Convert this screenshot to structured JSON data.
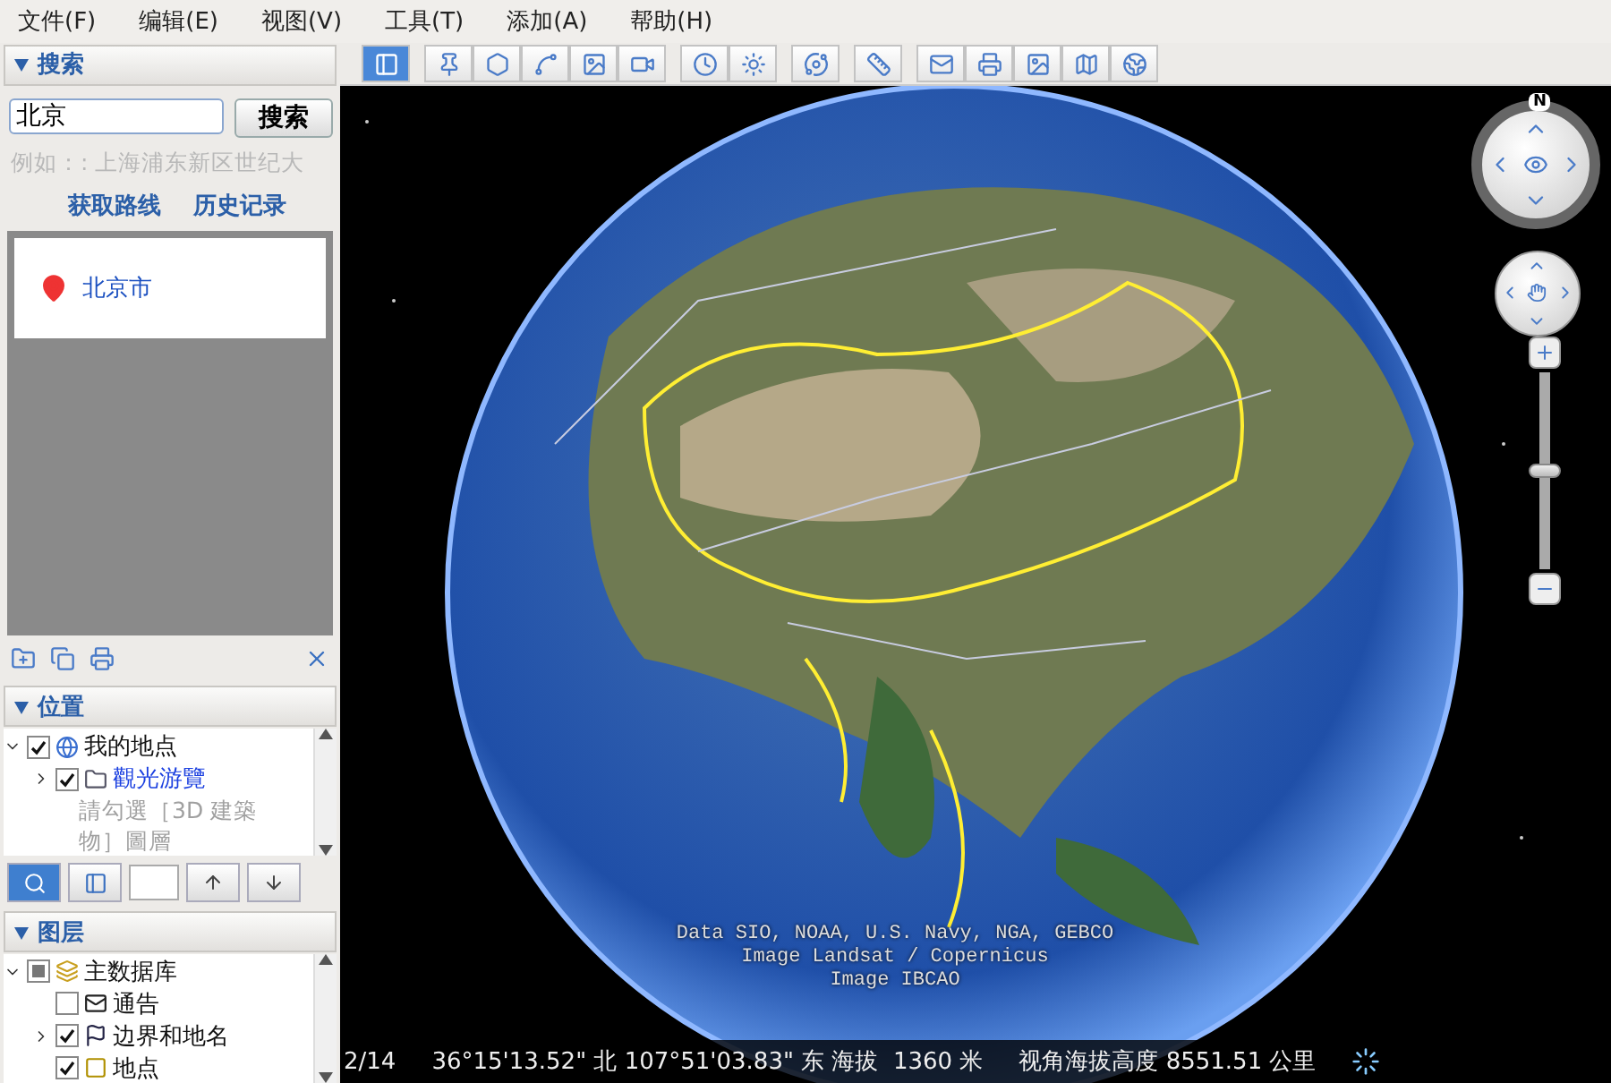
{
  "menu": [
    {
      "label": "文件(F)"
    },
    {
      "label": "编辑(E)"
    },
    {
      "label": "视图(V)"
    },
    {
      "label": "工具(T)"
    },
    {
      "label": "添加(A)"
    },
    {
      "label": "帮助(H)"
    }
  ],
  "search": {
    "title": "搜索",
    "expanded": true,
    "query": "北京",
    "button": "搜索",
    "hint": "例如：: 上海浦东新区世纪大",
    "links": [
      "获取路线",
      "历史记录"
    ],
    "results": [
      {
        "name": "北京市"
      }
    ]
  },
  "places": {
    "title": "位置",
    "expanded": true,
    "tree": [
      {
        "label": "我的地点",
        "kind": "globe",
        "checked": true,
        "expanded": true,
        "link": false,
        "children": [
          {
            "label": "觀光游覽",
            "kind": "folder",
            "checked": true,
            "expanded": false,
            "link": true,
            "note": "請勾選［3D 建築物］圖層"
          }
        ]
      }
    ]
  },
  "layers_toolbar": [
    {
      "kind": "search",
      "selected": true
    },
    {
      "kind": "panel",
      "selected": false
    }
  ],
  "layers": {
    "title": "图层",
    "expanded": true,
    "tree": [
      {
        "label": "主数据库",
        "kind": "layers",
        "checked": false,
        "partial": true,
        "expanded": true,
        "link": false,
        "children": [
          {
            "label": "通告",
            "kind": "mail",
            "checked": false,
            "link": false
          },
          {
            "label": "边界和地名",
            "kind": "flag",
            "checked": true,
            "expanded": false,
            "link": false
          },
          {
            "label": "地点",
            "kind": "square",
            "checked": true,
            "link": false
          }
        ]
      }
    ]
  },
  "toolbar": [
    [
      {
        "kind": "sidebar",
        "selected": true
      }
    ],
    [
      {
        "kind": "placemark",
        "selected": false
      },
      {
        "kind": "polygon",
        "selected": false
      },
      {
        "kind": "path",
        "selected": false
      },
      {
        "kind": "overlay",
        "selected": false
      },
      {
        "kind": "tour",
        "selected": false
      }
    ],
    [
      {
        "kind": "history",
        "selected": false
      },
      {
        "kind": "sun",
        "selected": false
      }
    ],
    [
      {
        "kind": "planet",
        "selected": false
      }
    ],
    [
      {
        "kind": "ruler",
        "selected": false
      }
    ],
    [
      {
        "kind": "email",
        "selected": false
      },
      {
        "kind": "print",
        "selected": false
      },
      {
        "kind": "save",
        "selected": false
      },
      {
        "kind": "map",
        "selected": false
      },
      {
        "kind": "earth",
        "selected": false
      }
    ]
  ],
  "compass": {
    "north": "N"
  },
  "zoom": {
    "level": 0.5
  },
  "credits": [
    "Data SIO, NOAA, U.S. Navy, NGA, GEBCO",
    "Image Landsat / Copernicus",
    "Image IBCAO"
  ],
  "status_bar": {
    "date": "2/14",
    "position": "36°15'13.52\" 北 107°51'03.83\" 东 海拔  1360 米",
    "eye_altitude": "视角海拔高度 8551.51 公里"
  }
}
